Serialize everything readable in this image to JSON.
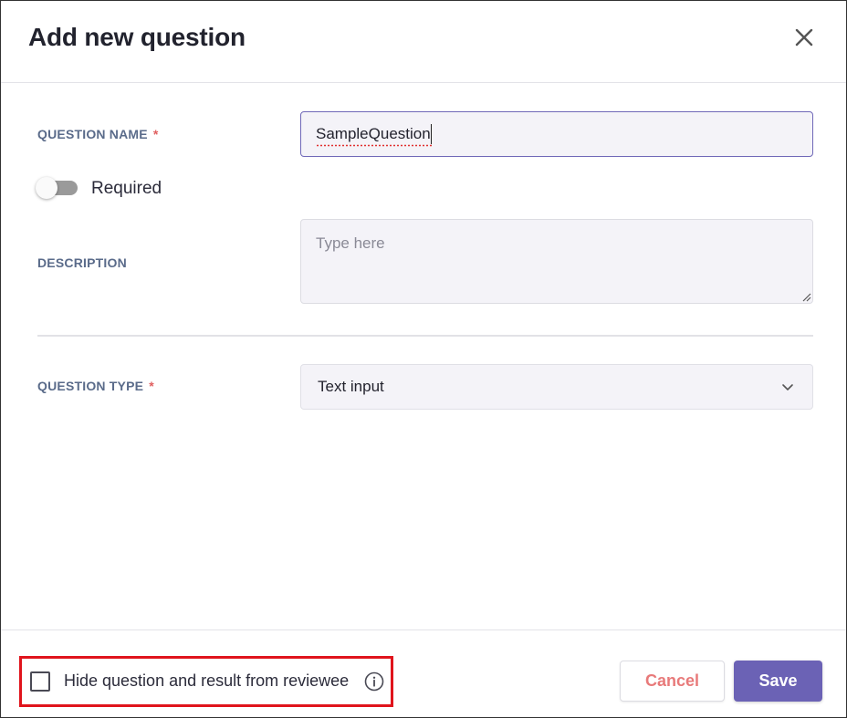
{
  "dialog": {
    "title": "Add new question",
    "close_icon": "close-icon"
  },
  "form": {
    "question_name": {
      "label": "QUESTION NAME",
      "required_marker": "*",
      "value": "SampleQuestion"
    },
    "required_toggle": {
      "label": "Required",
      "on": false
    },
    "description": {
      "label": "DESCRIPTION",
      "placeholder": "Type here",
      "value": ""
    },
    "question_type": {
      "label": "QUESTION TYPE",
      "required_marker": "*",
      "selected": "Text input",
      "icon": "chevron-down-icon"
    }
  },
  "footer": {
    "hide_checkbox": {
      "label": "Hide question and result from reviewee",
      "checked": false,
      "icon": "info-icon"
    },
    "cancel_label": "Cancel",
    "save_label": "Save"
  },
  "colors": {
    "accent": "#6b62b5",
    "cancel_text": "#e87a7a",
    "required_star": "#e06060",
    "label": "#5a6b8a",
    "highlight": "#e0141c"
  }
}
